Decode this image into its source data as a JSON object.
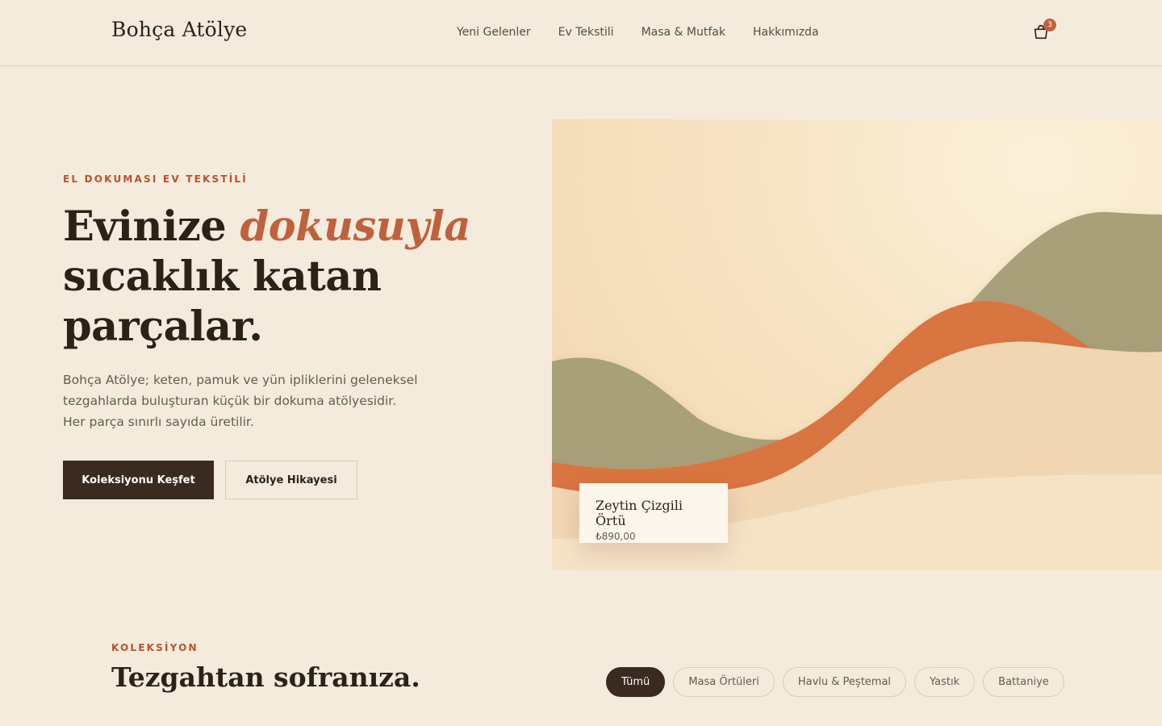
{
  "header": {
    "logo": "Bohça Atölye",
    "nav": [
      "Yeni Gelenler",
      "Ev Tekstili",
      "Masa & Mutfak",
      "Hakkımızda"
    ],
    "cart_count": "3",
    "cart_icon": "shopping-bag-icon"
  },
  "hero": {
    "eyebrow": "EL DOKUMASI EV TEKSTİLİ",
    "title_part1": "Evinize ",
    "title_emphasis": "dokusuyla",
    "title_part2": "sıcaklık katan parçalar.",
    "description": "Bohça Atölye; keten, pamuk ve yün ipliklerini geleneksel tezgahlarda buluşturan küçük bir dokuma atölyesidir. Her parça sınırlı sayıda üretilir.",
    "primary_button": "Koleksiyonu Keşfet",
    "secondary_button": "Atölye Hikayesi",
    "colors": {
      "accent": "#c0613b",
      "dark": "#3a2a1f",
      "olive": "#a8a079",
      "terracotta": "#d9743f"
    }
  },
  "featured_product": {
    "name": "Zeytin Çizgili Örtü",
    "price": "₺890,00"
  },
  "collection": {
    "eyebrow": "KOLEKSİYON",
    "title": "Tezgahtan sofranıza.",
    "filters": [
      "Tümü",
      "Masa Örtüleri",
      "Havlu & Peştemal",
      "Yastık",
      "Battaniye"
    ],
    "active_filter": "Tümü"
  }
}
